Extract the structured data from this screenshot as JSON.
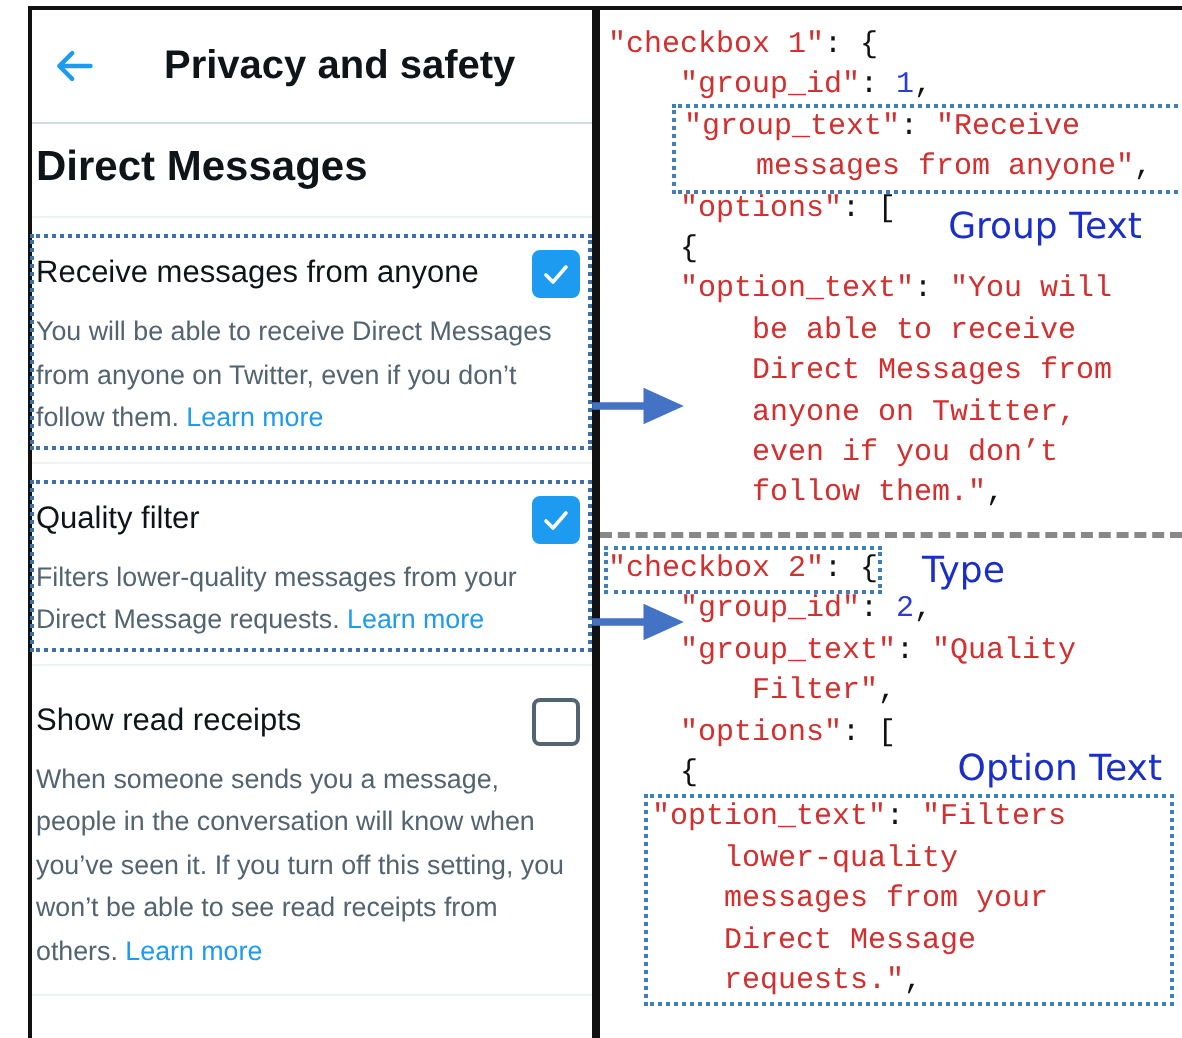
{
  "phone": {
    "title": "Privacy and safety",
    "section_title": "Direct Messages",
    "settings": [
      {
        "title": "Receive messages from anyone",
        "checked": true,
        "highlighted": true,
        "linked": true,
        "description": "You will be able to receive Direct Messages from anyone on Twitter, even if you don’t follow them.",
        "link": "Learn more"
      },
      {
        "title": "Quality filter",
        "checked": true,
        "highlighted": true,
        "linked": true,
        "description": "Filters lower-quality messages from your Direct Message requests.",
        "link": "Learn more"
      },
      {
        "title": "Show read receipts",
        "checked": false,
        "highlighted": false,
        "linked": false,
        "description": "When someone sends you a message, people in the conversation will know when you’ve seen it. If you turn off this setting, you won’t be able to see read receipts from others.",
        "link": "Learn more"
      }
    ]
  },
  "code": {
    "sections": [
      {
        "blocks": [
          {
            "lines": [
              {
                "kind": "head",
                "tokens": [
                  {
                    "kind": "string",
                    "t": "\"checkbox 1\""
                  },
                  {
                    "kind": "punct",
                    "t": ": {"
                  }
                ]
              },
              {
                "kind": "field",
                "tokens": [
                  {
                    "kind": "string",
                    "t": "\"group_id\""
                  },
                  {
                    "kind": "punct",
                    "t": ": "
                  },
                  {
                    "kind": "number",
                    "t": "1"
                  },
                  {
                    "kind": "punct",
                    "t": ","
                  }
                ]
              }
            ]
          },
          {
            "annotation": {
              "kind": "below",
              "label": "Group Text"
            },
            "lines": [
              {
                "kind": "field",
                "tokens": [
                  {
                    "kind": "string",
                    "t": "\"group_text\""
                  },
                  {
                    "kind": "punct",
                    "t": ": "
                  },
                  {
                    "kind": "string",
                    "t": "\"Receive"
                  }
                ]
              },
              {
                "kind": "wrap",
                "tokens": [
                  {
                    "kind": "string",
                    "t": "messages from anyone\""
                  },
                  {
                    "kind": "punct",
                    "t": ","
                  }
                ]
              }
            ]
          },
          {
            "lines": [
              {
                "kind": "field",
                "tokens": [
                  {
                    "kind": "string",
                    "t": "\"options\""
                  },
                  {
                    "kind": "punct",
                    "t": ": ["
                  }
                ]
              },
              {
                "kind": "field",
                "tokens": [
                  {
                    "kind": "punct",
                    "t": "{"
                  }
                ]
              },
              {
                "kind": "field",
                "tokens": [
                  {
                    "kind": "string",
                    "t": "\"option_text\""
                  },
                  {
                    "kind": "punct",
                    "t": ": "
                  },
                  {
                    "kind": "string",
                    "t": "\"You will"
                  }
                ]
              },
              {
                "kind": "wrap",
                "tokens": [
                  {
                    "kind": "string",
                    "t": "be able to receive"
                  }
                ]
              },
              {
                "kind": "wrap",
                "tokens": [
                  {
                    "kind": "string",
                    "t": "Direct Messages from"
                  }
                ]
              },
              {
                "kind": "wrap",
                "tokens": [
                  {
                    "kind": "string",
                    "t": "anyone on Twitter,"
                  }
                ]
              },
              {
                "kind": "wrap",
                "tokens": [
                  {
                    "kind": "string",
                    "t": "even if you don’t"
                  }
                ]
              },
              {
                "kind": "wrap",
                "tokens": [
                  {
                    "kind": "string",
                    "t": "follow them.\""
                  },
                  {
                    "kind": "punct",
                    "t": ","
                  }
                ]
              }
            ]
          }
        ]
      },
      {
        "blocks": [
          {
            "annotation": {
              "kind": "right",
              "label": "Type"
            },
            "lines": [
              {
                "kind": "head",
                "tokens": [
                  {
                    "kind": "string",
                    "t": "\"checkbox 2\""
                  },
                  {
                    "kind": "punct",
                    "t": ": {"
                  }
                ]
              }
            ]
          },
          {
            "lines": [
              {
                "kind": "field",
                "tokens": [
                  {
                    "kind": "string",
                    "t": "\"group_id\""
                  },
                  {
                    "kind": "punct",
                    "t": ": "
                  },
                  {
                    "kind": "number",
                    "t": "2"
                  },
                  {
                    "kind": "punct",
                    "t": ","
                  }
                ]
              },
              {
                "kind": "field",
                "tokens": [
                  {
                    "kind": "string",
                    "t": "\"group_text\""
                  },
                  {
                    "kind": "punct",
                    "t": ": "
                  },
                  {
                    "kind": "string",
                    "t": "\"Quality"
                  }
                ]
              },
              {
                "kind": "wrap",
                "tokens": [
                  {
                    "kind": "string",
                    "t": "Filter\""
                  },
                  {
                    "kind": "punct",
                    "t": ","
                  }
                ]
              },
              {
                "kind": "field",
                "tokens": [
                  {
                    "kind": "string",
                    "t": "\"options\""
                  },
                  {
                    "kind": "punct",
                    "t": ": ["
                  }
                ]
              },
              {
                "kind": "field",
                "tokens": [
                  {
                    "kind": "punct",
                    "t": "{"
                  }
                ]
              }
            ]
          },
          {
            "annotation": {
              "kind": "above",
              "label": "Option Text"
            },
            "lines": [
              {
                "kind": "field",
                "tokens": [
                  {
                    "kind": "string",
                    "t": "\"option_text\""
                  },
                  {
                    "kind": "punct",
                    "t": ": "
                  },
                  {
                    "kind": "string",
                    "t": "\"Filters"
                  }
                ]
              },
              {
                "kind": "wrap",
                "tokens": [
                  {
                    "kind": "string",
                    "t": "lower-quality"
                  }
                ]
              },
              {
                "kind": "wrap",
                "tokens": [
                  {
                    "kind": "string",
                    "t": "messages from your"
                  }
                ]
              },
              {
                "kind": "wrap",
                "tokens": [
                  {
                    "kind": "string",
                    "t": "Direct Message"
                  }
                ]
              },
              {
                "kind": "wrap",
                "tokens": [
                  {
                    "kind": "string",
                    "t": "requests.\""
                  },
                  {
                    "kind": "punct",
                    "t": ","
                  }
                ]
              }
            ]
          }
        ]
      }
    ]
  }
}
